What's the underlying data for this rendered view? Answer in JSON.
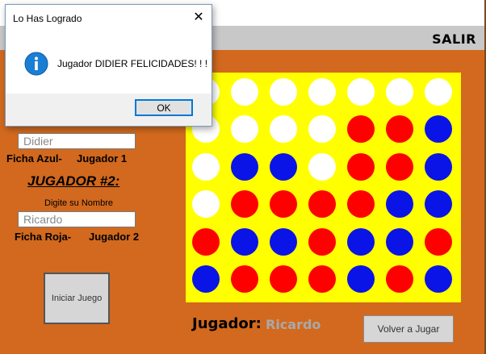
{
  "dialog": {
    "title": "Lo Has Logrado",
    "close": "✕",
    "info_icon": "info-icon",
    "message": "Jugador DIDIER FELICIDADES! ! !",
    "ok_label": "OK"
  },
  "topbar": {
    "salir_label": "SALIR"
  },
  "player1": {
    "name_value": "Didier",
    "piece_label": "Ficha Azul-",
    "player_label": "Jugador 1"
  },
  "player2": {
    "heading": "JUGADOR #2:",
    "prompt": "Digite su Nombre",
    "name_value": "Ricardo",
    "piece_label": "Ficha Roja-",
    "player_label": "Jugador 2"
  },
  "buttons": {
    "iniciar_label": "Iniciar Juego",
    "volver_label": "Volver a Jugar"
  },
  "turn": {
    "label": "Jugador:",
    "name": "Ricardo"
  },
  "colors": {
    "white": "#ffffff",
    "red": "#ff0000",
    "blue": "#0a14e6",
    "board": "#ffff00",
    "background": "#d2691e"
  },
  "board": {
    "rows": 6,
    "cols": 7,
    "cells": [
      [
        "white",
        "white",
        "white",
        "white",
        "white",
        "white",
        "white"
      ],
      [
        "white",
        "white",
        "white",
        "white",
        "red",
        "red",
        "blue"
      ],
      [
        "white",
        "blue",
        "blue",
        "white",
        "red",
        "red",
        "blue"
      ],
      [
        "white",
        "red",
        "red",
        "red",
        "red",
        "blue",
        "blue"
      ],
      [
        "red",
        "blue",
        "blue",
        "red",
        "blue",
        "blue",
        "red"
      ],
      [
        "blue",
        "red",
        "red",
        "red",
        "blue",
        "red",
        "blue"
      ]
    ]
  }
}
